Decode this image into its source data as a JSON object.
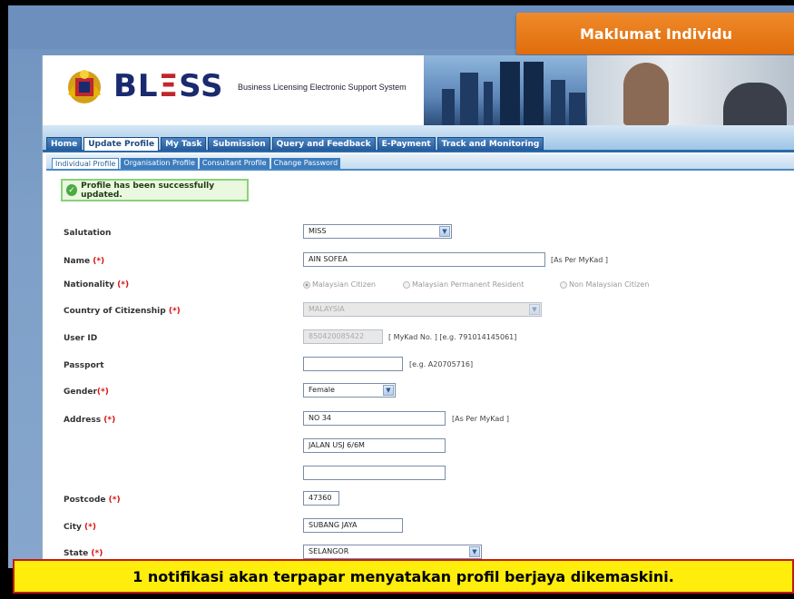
{
  "banner": {
    "title": "Maklumat Individu"
  },
  "header": {
    "logo_prefix": "BL",
    "logo_eq": "Ξ",
    "logo_suffix": "SS",
    "tagline": "Business Licensing Electronic Support System"
  },
  "nav": {
    "tabs": [
      "Home",
      "Update Profile",
      "My Task",
      "Submission",
      "Query and Feedback",
      "E-Payment",
      "Track and Monitoring"
    ],
    "active": "Update Profile"
  },
  "subnav": {
    "tabs": [
      "Individual Profile",
      "Organisation Profile",
      "Consultant Profile",
      "Change Password"
    ],
    "active": "Individual Profile"
  },
  "success_message": "Profile has been successfully updated.",
  "form": {
    "salutation": {
      "label": "Salutation",
      "value": "MISS"
    },
    "name": {
      "label": "Name ",
      "req": "(*)",
      "value": "AIN SOFEA",
      "hint": "[As Per MyKad ]"
    },
    "nationality": {
      "label": "Nationality  ",
      "req": "(*)",
      "options": [
        "Malaysian Citizen",
        "Malaysian Permanent Resident",
        "Non Malaysian Citizen"
      ]
    },
    "country": {
      "label": "Country of Citizenship  ",
      "req": "(*)",
      "value": "MALAYSIA"
    },
    "user_id": {
      "label": "User ID",
      "value": "850420085422",
      "hint": "[ MyKad No. ] [e.g. 791014145061]"
    },
    "passport": {
      "label": "Passport",
      "value": "",
      "hint": "[e.g. A20705716]"
    },
    "gender": {
      "label": "Gender",
      "req": "(*)",
      "value": "Female"
    },
    "address": {
      "label": "Address  ",
      "req": "(*)",
      "line1": "NO 34",
      "line2": "JALAN USJ 6/6M",
      "line3": "",
      "hint": "[As Per MyKad ]"
    },
    "postcode": {
      "label": "Postcode  ",
      "req": "(*)",
      "value": "47360"
    },
    "city": {
      "label": "City  ",
      "req": "(*)",
      "value": "SUBANG JAYA"
    },
    "state": {
      "label": "State  ",
      "req": "(*)",
      "value": "SELANGOR"
    }
  },
  "caption": "1 notifikasi akan terpapar menyatakan profil berjaya dikemaskini."
}
